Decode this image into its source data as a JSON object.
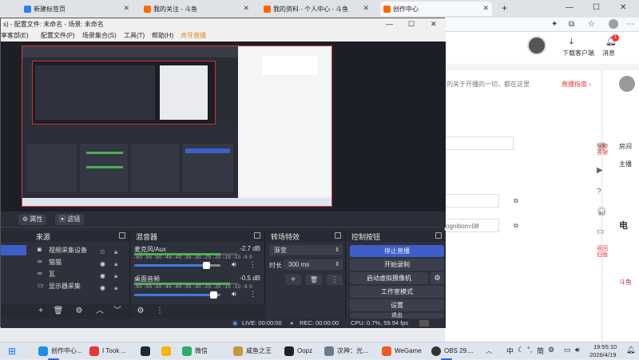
{
  "browser": {
    "tabs": [
      {
        "label": "新建标签页",
        "color": "#2d7ff9"
      },
      {
        "label": "我的关注 - 斗鱼",
        "color": "#ff6a00"
      },
      {
        "label": "我的资料 - 个人中心 - 斗鱼",
        "color": "#ff6a00"
      },
      {
        "label": "创作中心",
        "color": "#ff6a00"
      }
    ],
    "new_tab": "+"
  },
  "douyu": {
    "download_label": "下载客户端",
    "message_label": "消息",
    "message_badge": "1",
    "intro_text": "的关于开播的一切，都在这里",
    "guide_link": "直播指南 ›",
    "field_text": "ognition=08",
    "side_items": [
      "房间",
      "礼物\n答谢",
      "主播",
      "电",
      "返回\n旧版",
      "斗鱼"
    ]
  },
  "obs": {
    "title": "s) - 配置文件: 未命名 - 场景: 未命名",
    "menu": [
      "享客部(E)",
      "配置文件(P)",
      "场景集合(S)",
      "工具(T)",
      "帮助(H)",
      "虎牙直播"
    ],
    "props_label": "属性",
    "filters_label": "滤镜",
    "docks": {
      "sources_title": "来源",
      "mixer_title": "混音器",
      "transitions_title": "转场特效",
      "controls_title": "控制按钮"
    },
    "sources": [
      {
        "label": "视频采集设备",
        "icon": "camera-icon"
      },
      {
        "label": "猫猫",
        "icon": "glasses-icon"
      },
      {
        "label": "瓦",
        "icon": "glasses-icon"
      },
      {
        "label": "显示器采集",
        "icon": "monitor-icon"
      }
    ],
    "mixer": [
      {
        "name": "麦克风/Aux",
        "db": "-2.7 dB",
        "level": 0.83
      },
      {
        "name": "桌面音频",
        "db": "-0.5 dB",
        "level": 0.92
      }
    ],
    "mixer_scale": "-60 -55 -50 -45 -40 -35 -30 -25 -20 -15 -10 -5 0",
    "transition": {
      "type": "渐变",
      "duration_label": "时长",
      "duration": "300 ms"
    },
    "controls": [
      "停止直播",
      "开始录制",
      "启动虚拟摄像机",
      "工作室模式",
      "设置",
      "退出"
    ],
    "status": {
      "live": "LIVE: 00:00:00",
      "rec": "REC: 00:00:00",
      "cpu": "CPU: 0.7%, 59.94 fps"
    }
  },
  "taskbar": {
    "items": [
      {
        "label": "创作中心...",
        "color": "#1f8fe6"
      },
      {
        "label": "I Took ...",
        "color": "#e53935"
      },
      {
        "label": "",
        "color": "#1b2838"
      },
      {
        "label": "",
        "color": "#f7b500"
      },
      {
        "label": "微信",
        "color": "#2aae67"
      },
      {
        "label": "咸鱼之王",
        "color": "#c29a3c"
      },
      {
        "label": "Oopz",
        "color": "#222222"
      },
      {
        "label": "次神：光...",
        "color": "#6c7a8a"
      },
      {
        "label": "WeGame",
        "color": "#f05a28"
      },
      {
        "label": "OBS 29....",
        "color": "#333333"
      }
    ],
    "tray": {
      "lang": "中",
      "ime": "简",
      "time": "19:55:10",
      "date": "2026/4/19"
    }
  }
}
